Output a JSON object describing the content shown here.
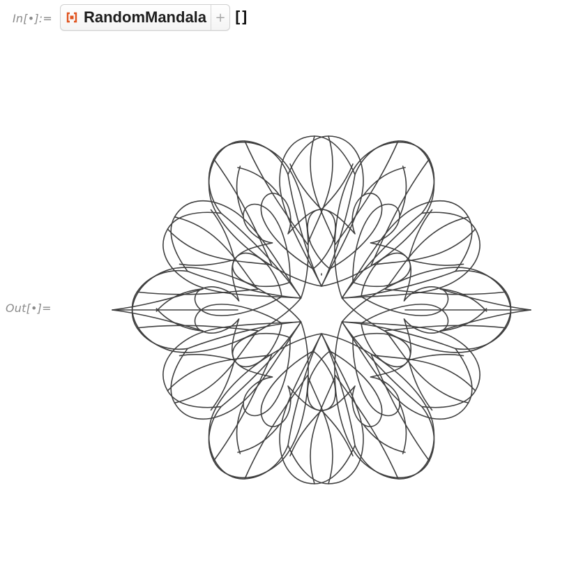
{
  "notebook": {
    "input_label": "In[•]:=",
    "output_label": "Out[•]=",
    "resource_function_name": "RandomMandala",
    "plus_symbol": "+",
    "brackets": "[]"
  },
  "icons": {
    "resource_icon": "resource-function-icon",
    "plus_icon": "plus-icon"
  },
  "colors": {
    "resource_icon_orange": "#e0531e",
    "stroke": "#3f3f3f"
  }
}
